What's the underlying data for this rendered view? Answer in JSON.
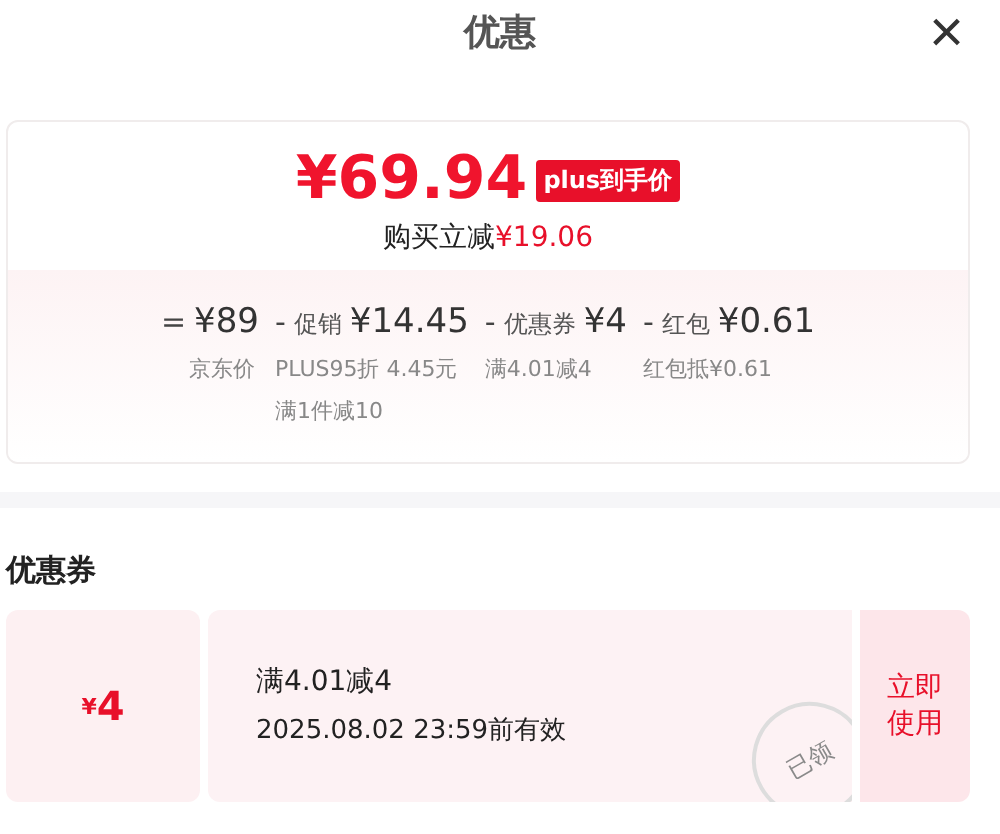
{
  "header": {
    "title": "优惠",
    "close": "×"
  },
  "summary": {
    "price": "¥69.94",
    "badge": "plus到手价",
    "saving_label": "购买立减",
    "saving_amount": "¥19.06",
    "breakdown": [
      {
        "operator": "=",
        "amount": "¥89",
        "notes": [
          "京东价"
        ]
      },
      {
        "operator": "-",
        "label": "促销",
        "amount": "¥14.45",
        "notes": [
          "PLUS95折 4.45元",
          "满1件减10"
        ]
      },
      {
        "operator": "-",
        "label": "优惠券",
        "amount": "¥4",
        "notes": [
          "满4.01减4"
        ]
      },
      {
        "operator": "-",
        "label": "红包",
        "amount": "¥0.61",
        "notes": [
          "红包抵¥0.61"
        ]
      }
    ]
  },
  "coupons_section": {
    "title": "优惠券",
    "coupons": [
      {
        "currency": "¥",
        "value": "4",
        "condition": "满4.01减4",
        "validity": "2025.08.02 23:59前有效",
        "stamp": "已领",
        "action": "立即使用"
      }
    ]
  }
}
